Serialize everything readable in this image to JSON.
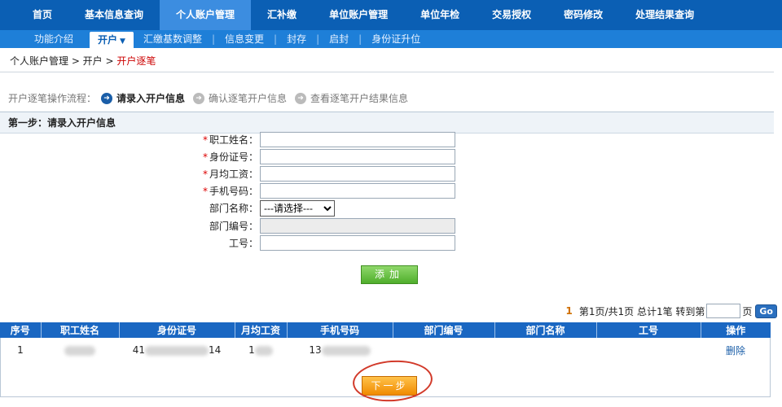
{
  "topnav": [
    "首页",
    "基本信息查询",
    "个人账户管理",
    "汇补缴",
    "单位账户管理",
    "单位年检",
    "交易授权",
    "密码修改",
    "处理结果查询"
  ],
  "subnav": {
    "intro": "功能介绍",
    "active": "开户",
    "items": [
      "汇缴基数调整",
      "信息变更",
      "封存",
      "启封",
      "身份证升位"
    ]
  },
  "breadcrumb": {
    "path": "个人账户管理 > 开户 > ",
    "current": "开户逐笔"
  },
  "flow": {
    "label": "开户逐笔操作流程：",
    "steps": [
      "请录入开户信息",
      "确认逐笔开户信息",
      "查看逐笔开户结果信息"
    ]
  },
  "step": {
    "title": "第一步：请录入开户信息"
  },
  "form": {
    "name_label": "职工姓名：",
    "id_label": "身份证号：",
    "salary_label": "月均工资：",
    "phone_label": "手机号码：",
    "dept_label": "部门名称：",
    "dept_select": "---请选择---",
    "deptno_label": "部门编号：",
    "jobno_label": "工号："
  },
  "add_button": "添加",
  "pager": {
    "current": "1",
    "info": "第1页/共1页 总计1笔 转到第",
    "suffix": "页",
    "go": "Go"
  },
  "table": {
    "headers": [
      "序号",
      "职工姓名",
      "身份证号",
      "月均工资",
      "手机号码",
      "部门编号",
      "部门名称",
      "工号",
      "操作"
    ],
    "row": {
      "index": "1",
      "id_prefix": "41",
      "id_suffix": "14",
      "salary_prefix": "1",
      "phone_prefix": "13",
      "action": "删除"
    }
  },
  "next_button": "下一步"
}
